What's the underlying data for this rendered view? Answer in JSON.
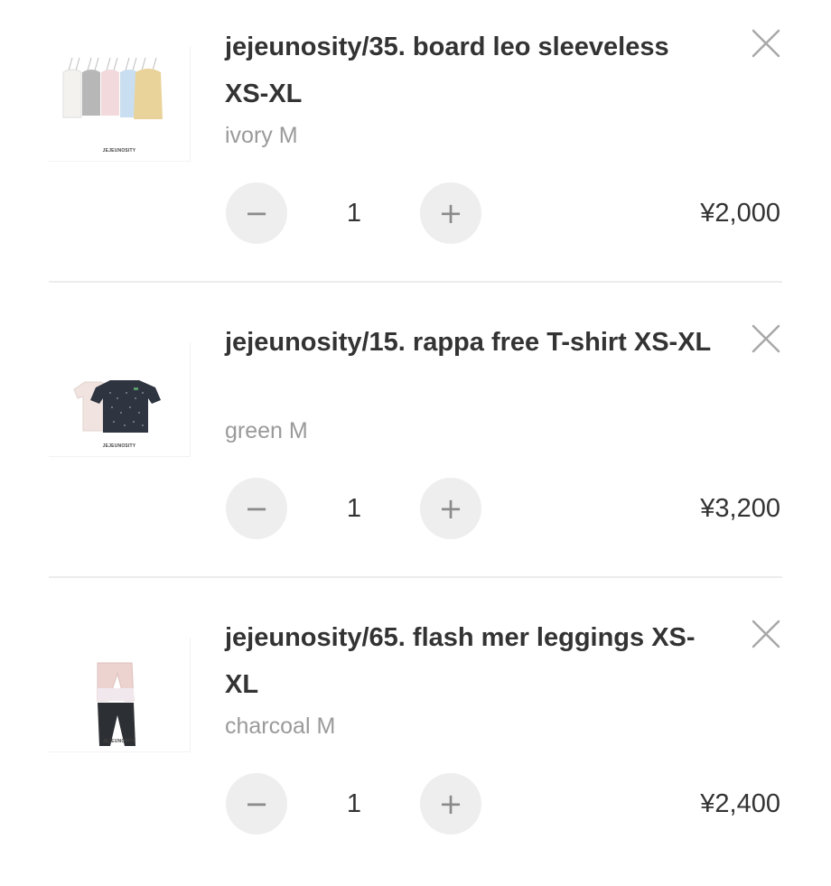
{
  "cart": {
    "items": [
      {
        "title": "jejeunosity/35. board leo sleeveless XS-XL",
        "variant": "ivory M",
        "quantity": "1",
        "price": "¥2,000",
        "minus_label": "−",
        "plus_label": "+",
        "thumbnail_brand": "JEJEUNOSITY",
        "thumbnail_icon": "camisole-colorways-image"
      },
      {
        "title": "jejeunosity/15. rappa free T-shirt XS-XL",
        "variant": "green M",
        "quantity": "1",
        "price": "¥3,200",
        "minus_label": "−",
        "plus_label": "+",
        "thumbnail_brand": "JEJEUNOSITY",
        "thumbnail_icon": "tshirt-image"
      },
      {
        "title": "jejeunosity/65. flash mer leggings XS-XL",
        "variant": "charcoal M",
        "quantity": "1",
        "price": "¥2,400",
        "minus_label": "−",
        "plus_label": "+",
        "thumbnail_brand": "JEJEUNOSITY",
        "thumbnail_icon": "leggings-image"
      }
    ]
  },
  "colors": {
    "text": "#333333",
    "muted": "#9a9a9a",
    "button_bg": "#eeeeee",
    "divider": "#ececec"
  }
}
